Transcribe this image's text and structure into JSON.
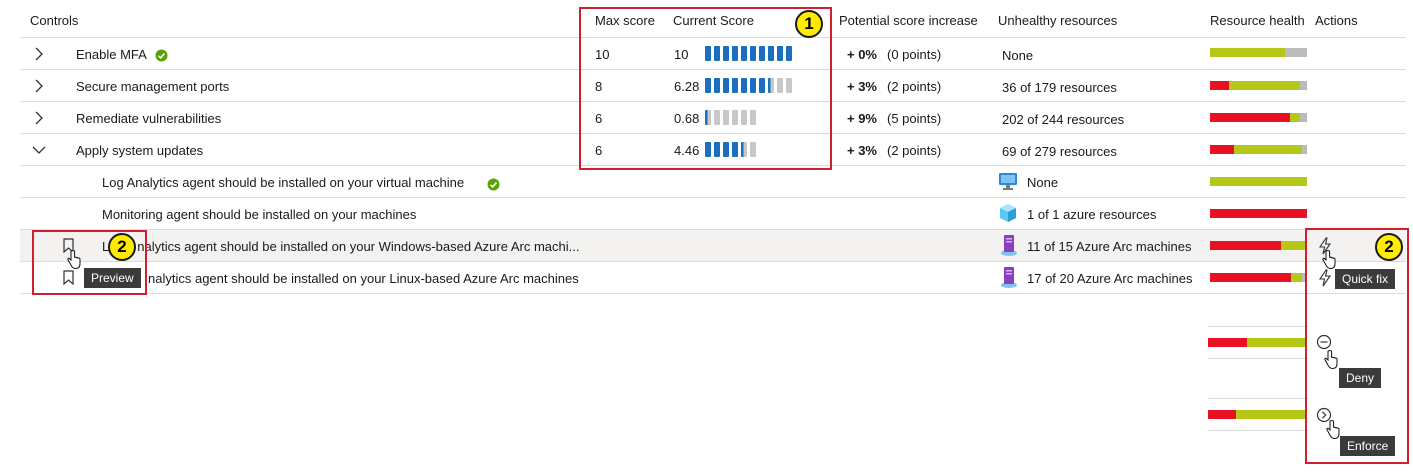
{
  "headers": {
    "controls": "Controls",
    "max_score": "Max score",
    "current_score": "Current Score",
    "potential": "Potential score increase",
    "unhealthy": "Unhealthy resources",
    "health": "Resource health",
    "actions": "Actions"
  },
  "rows": [
    {
      "name": "Enable MFA",
      "max": "10",
      "current": "10",
      "pot_pct": "+ 0%",
      "pot_pts": "(0 points)",
      "unhealthy": "None",
      "score_fraction": 1.0,
      "health": {
        "red": 0,
        "green": 0.84,
        "gray": 0.16
      }
    },
    {
      "name": "Secure management ports",
      "max": "8",
      "current": "6.28",
      "pot_pct": "+ 3%",
      "pot_pts": "(2 points)",
      "unhealthy": "36 of 179 resources",
      "score_fraction": 0.785,
      "health": {
        "red": 0.2,
        "green": 0.72,
        "gray": 0.08
      }
    },
    {
      "name": "Remediate vulnerabilities",
      "max": "6",
      "current": "0.68",
      "pot_pct": "+ 9%",
      "pot_pts": "(5 points)",
      "unhealthy": "202 of 244 resources",
      "score_fraction": 0.113,
      "health": {
        "red": 0.83,
        "green": 0.1,
        "gray": 0.07
      }
    },
    {
      "name": "Apply system updates",
      "max": "6",
      "current": "4.46",
      "pot_pct": "+ 3%",
      "pot_pts": "(2 points)",
      "unhealthy": "69 of 279 resources",
      "score_fraction": 0.743,
      "health": {
        "red": 0.25,
        "green": 0.7,
        "gray": 0.05
      }
    }
  ],
  "subrows": [
    {
      "name": "Log Analytics agent should be installed on your virtual machine",
      "unhealthy": "None",
      "icon": "monitor-icon",
      "health": {
        "red": 0,
        "green": 1,
        "gray": 0
      }
    },
    {
      "name": "Monitoring agent should be installed on your machines",
      "unhealthy": "1 of 1 azure resources",
      "icon": "cube-icon",
      "health": {
        "red": 1,
        "green": 0,
        "gray": 0
      }
    },
    {
      "name": "Log Analytics agent should be installed on your Windows-based Azure Arc machi...",
      "visible_prefix": "L",
      "visible_suffix": "nalytics agent should be installed on your Windows-based Azure Arc machi...",
      "unhealthy": "11 of 15 Azure Arc machines",
      "icon": "server-icon",
      "health": {
        "red": 0.73,
        "green": 0.27,
        "gray": 0
      }
    },
    {
      "name": "Log Analytics agent should be installed on your Linux-based Azure Arc machines",
      "visible_suffix": "nalytics agent should be installed on your Linux-based Azure Arc machines",
      "unhealthy": "17 of 20 Azure Arc machines",
      "icon": "server-icon",
      "health": {
        "red": 0.85,
        "green": 0.1,
        "gray": 0.05
      }
    }
  ],
  "callouts": {
    "badge1": "1",
    "badge2a": "2",
    "badge2b": "2",
    "preview": "Preview",
    "quick_fix": "Quick fix",
    "deny": "Deny",
    "enforce": "Enforce"
  },
  "colors": {
    "accent_blue": "#1a6fbf",
    "health_red": "#e81123",
    "health_green": "#b5c818",
    "callout_red": "#d0202f",
    "badge_yellow": "#ffeb00"
  }
}
